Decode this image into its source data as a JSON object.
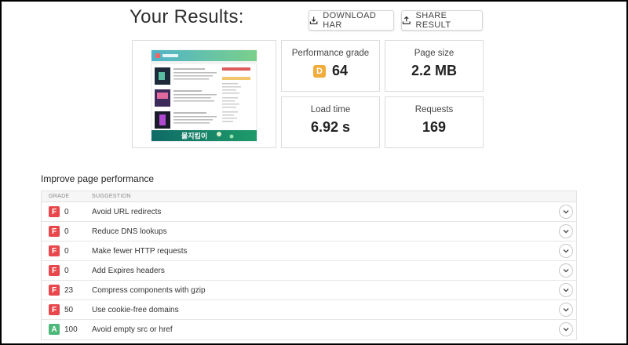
{
  "header": {
    "title": "Your Results:",
    "download_label": "DOWNLOAD HAR",
    "share_label": "SHARE RESULT"
  },
  "metrics": {
    "performance_grade": {
      "label": "Performance grade",
      "letter": "D",
      "value": "64",
      "color": "#f0ad3c"
    },
    "page_size": {
      "label": "Page size",
      "value": "2.2 MB"
    },
    "load_time": {
      "label": "Load time",
      "value": "6.92 s"
    },
    "requests": {
      "label": "Requests",
      "value": "169"
    }
  },
  "improve": {
    "title": "Improve page performance",
    "col_grade": "GRADE",
    "col_suggestion": "SUGGESTION",
    "rows": [
      {
        "grade": "F",
        "score": "0",
        "suggestion": "Avoid URL redirects"
      },
      {
        "grade": "F",
        "score": "0",
        "suggestion": "Reduce DNS lookups"
      },
      {
        "grade": "F",
        "score": "0",
        "suggestion": "Make fewer HTTP requests"
      },
      {
        "grade": "F",
        "score": "0",
        "suggestion": "Add Expires headers"
      },
      {
        "grade": "F",
        "score": "23",
        "suggestion": "Compress components with gzip"
      },
      {
        "grade": "F",
        "score": "50",
        "suggestion": "Use cookie-free domains"
      },
      {
        "grade": "A",
        "score": "100",
        "suggestion": "Avoid empty src or href"
      }
    ]
  },
  "colors": {
    "grade_F": "#e8474c",
    "grade_A": "#4cb87a",
    "grade_D": "#f0ad3c"
  },
  "screenshot_thumbnail": {
    "banner_text": "물지킴이"
  }
}
